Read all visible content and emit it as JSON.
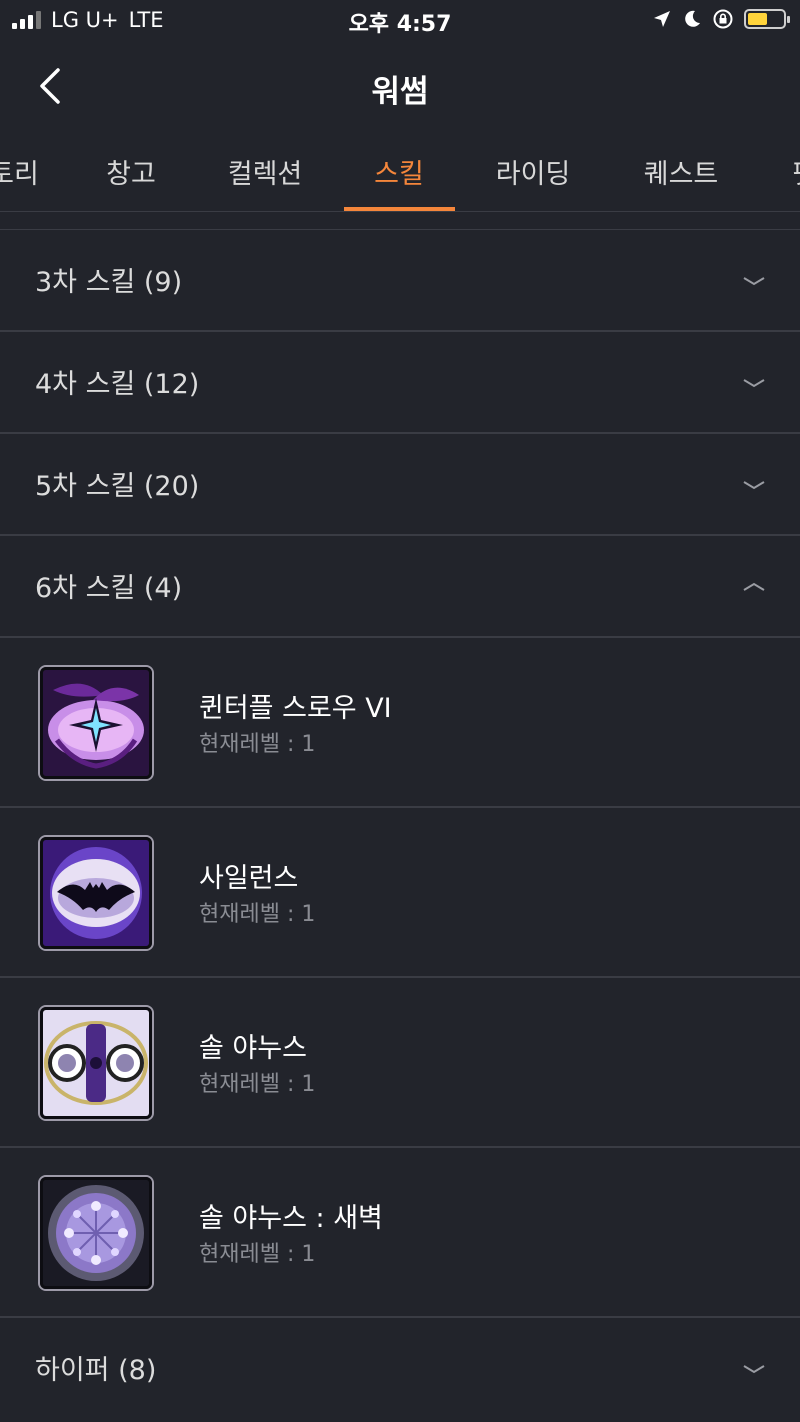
{
  "status_bar": {
    "carrier": "LG U+",
    "network": "LTE",
    "time": "오후 4:57"
  },
  "header": {
    "title": "워썸"
  },
  "tabs": [
    {
      "label": "토리"
    },
    {
      "label": "창고"
    },
    {
      "label": "컬렉션"
    },
    {
      "label": "스킬",
      "active": true
    },
    {
      "label": "라이딩"
    },
    {
      "label": "퀘스트"
    },
    {
      "label": "펫"
    }
  ],
  "sections": [
    {
      "label": "3차 스킬 (9)",
      "expanded": false
    },
    {
      "label": "4차 스킬 (12)",
      "expanded": false
    },
    {
      "label": "5차 스킬 (20)",
      "expanded": false
    },
    {
      "label": "6차 스킬 (4)",
      "expanded": true
    },
    {
      "label": "하이퍼 (8)",
      "expanded": false
    }
  ],
  "level_label": "현재레벨 : ",
  "skills": [
    {
      "name": "퀸터플 스로우 VI",
      "level": "1"
    },
    {
      "name": "사일런스",
      "level": "1"
    },
    {
      "name": "솔 야누스",
      "level": "1"
    },
    {
      "name": "솔 야누스 : 새벽",
      "level": "1"
    }
  ],
  "colors": {
    "background": "#22242b",
    "accent": "#f5863b",
    "divider": "#3a3c44"
  }
}
